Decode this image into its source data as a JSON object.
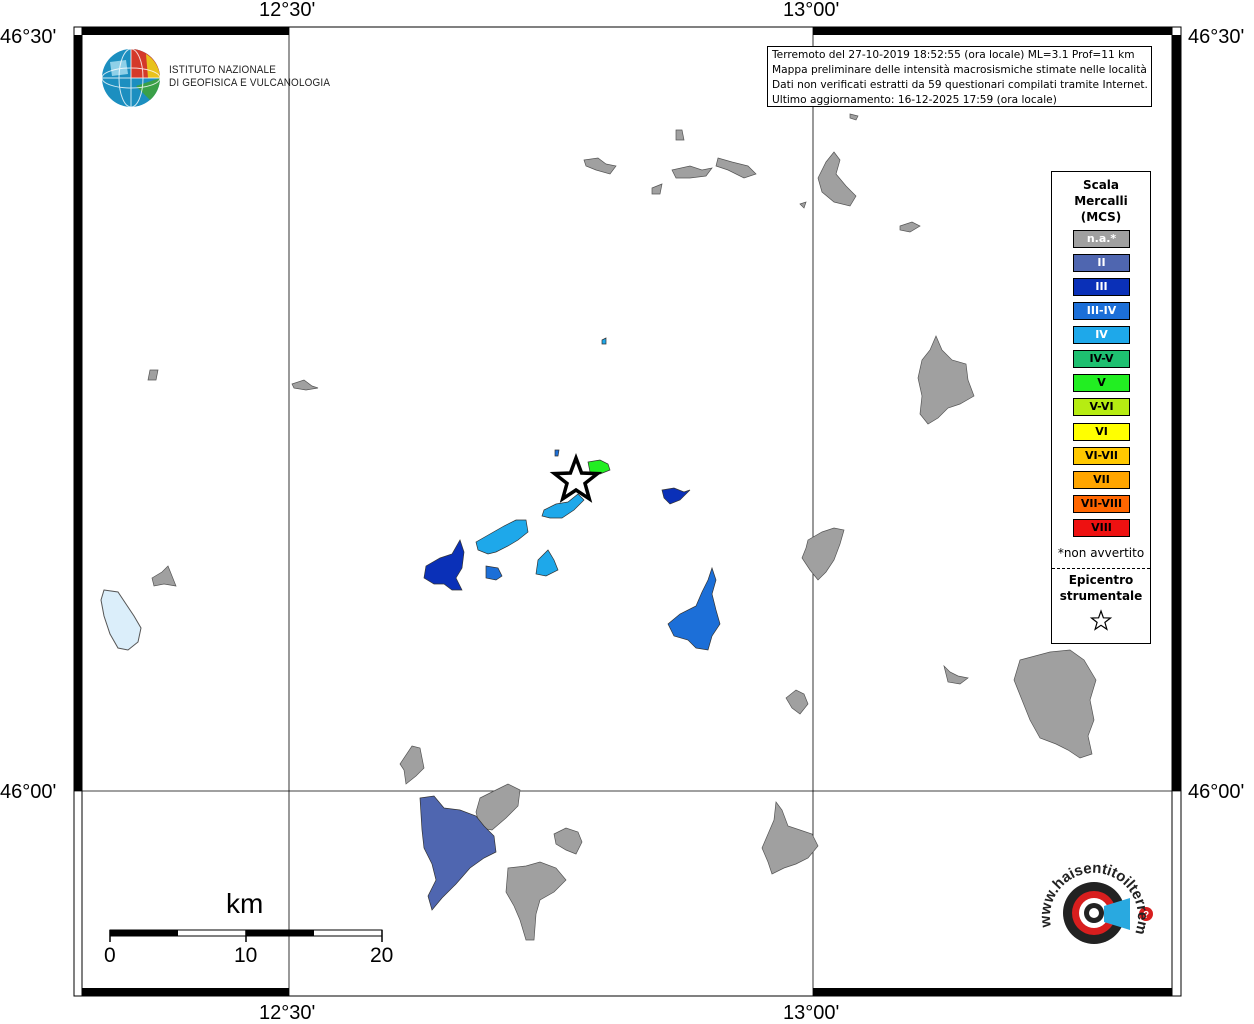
{
  "map": {
    "coords": {
      "top_left": "12°30'",
      "top_right": "13°00'",
      "bottom_left": "12°30'",
      "bottom_right": "13°00'",
      "left_top": "46°30'",
      "left_bottom": "46°00'",
      "right_top": "46°30'",
      "right_bottom": "46°00'"
    },
    "institute": {
      "line1": "ISTITUTO NAZIONALE",
      "line2": "DI GEOFISICA E VULCANOLOGIA"
    },
    "info": [
      "Terremoto del 27-10-2019 18:52:55 (ora locale) ML=3.1 Prof=11 km",
      "Mappa preliminare delle intensità macrosismiche stimate nelle località",
      "Dati non verificati estratti da 59 questionari compilati tramite Internet.",
      "Ultimo aggiornamento: 16-12-2025 17:59 (ora locale)"
    ],
    "legend": {
      "title1": "Scala",
      "title2": "Mercalli",
      "title3": "(MCS)",
      "items": [
        {
          "label": "n.a.*",
          "color": "#a0a0a0",
          "text": "#ffffff"
        },
        {
          "label": "II",
          "color": "#4f66b0",
          "text": "#ffffff"
        },
        {
          "label": "III",
          "color": "#0a30b8",
          "text": "#ffffff"
        },
        {
          "label": "III-IV",
          "color": "#1c6fd8",
          "text": "#ffffff"
        },
        {
          "label": "IV",
          "color": "#1ea8ea",
          "text": "#ffffff"
        },
        {
          "label": "IV-V",
          "color": "#1ec070",
          "text": "#000000"
        },
        {
          "label": "V",
          "color": "#22ee22",
          "text": "#000000"
        },
        {
          "label": "V-VI",
          "color": "#b6ec12",
          "text": "#000000"
        },
        {
          "label": "VI",
          "color": "#ffff00",
          "text": "#000000"
        },
        {
          "label": "VI-VII",
          "color": "#ffc800",
          "text": "#000000"
        },
        {
          "label": "VII",
          "color": "#ffa500",
          "text": "#000000"
        },
        {
          "label": "VII-VIII",
          "color": "#ff6600",
          "text": "#000000"
        },
        {
          "label": "VIII",
          "color": "#ee1111",
          "text": "#000000"
        }
      ],
      "note": "*non avvertito",
      "epicenter1": "Epicentro",
      "epicenter2": "strumentale"
    },
    "scale": {
      "unit": "km",
      "ticks": [
        "0",
        "10",
        "20"
      ]
    },
    "brand": {
      "text": "www.haisentitoilterremoto.it"
    }
  }
}
